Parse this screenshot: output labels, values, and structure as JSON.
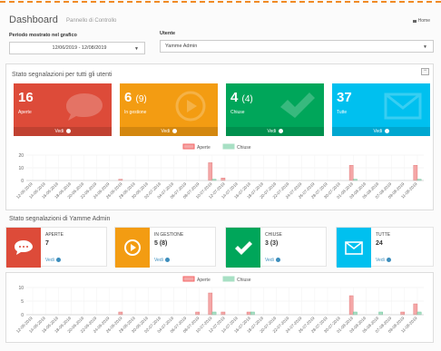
{
  "header": {
    "title": "Dashboard",
    "subtitle": "Pannello di Controllo",
    "home_label": "Home"
  },
  "filters": {
    "period_label": "Periodo mostrato nel grafico",
    "period_value": "12/06/2019 - 12/08/2019",
    "user_label": "Utente",
    "user_value": "Yamme Admin"
  },
  "section_all": {
    "title": "Stato segnalazioni per tutti gli utenti",
    "collapse_symbol": "−",
    "tiles": [
      {
        "num": "16",
        "sub": "",
        "label": "Aperte",
        "link": "Vedi",
        "color": "#dd4b39",
        "icon": "chat-icon"
      },
      {
        "num": "6",
        "sub": "(9)",
        "label": "In gestione",
        "link": "Vedi",
        "color": "#f39c12",
        "icon": "play-icon"
      },
      {
        "num": "4",
        "sub": "(4)",
        "label": "Chiuse",
        "link": "Vedi",
        "color": "#00a65a",
        "icon": "check-icon"
      },
      {
        "num": "37",
        "sub": "",
        "label": "Tutte",
        "link": "Vedi",
        "color": "#00c0ef",
        "icon": "envelope-icon"
      }
    ]
  },
  "section_user": {
    "title": "Stato segnalazioni di Yamme Admin",
    "tiles": [
      {
        "label": "APERTE",
        "value": "7",
        "link": "Vedi",
        "color": "#dd4b39",
        "icon": "chat-icon"
      },
      {
        "label": "IN GESTIONE",
        "value": "5 (8)",
        "link": "Vedi",
        "color": "#f39c12",
        "icon": "play-icon"
      },
      {
        "label": "CHIUSE",
        "value": "3 (3)",
        "link": "Vedi",
        "color": "#00a65a",
        "icon": "check-icon"
      },
      {
        "label": "TUTTE",
        "value": "24",
        "link": "Vedi",
        "color": "#00c0ef",
        "icon": "envelope-icon"
      }
    ]
  },
  "chart_data": [
    {
      "type": "bar",
      "ylim": [
        0,
        20
      ],
      "yticks": [
        "20",
        "10",
        "0"
      ],
      "categories": [
        "12-06-2019",
        "14-06-2019",
        "16-06-2019",
        "18-06-2019",
        "20-06-2019",
        "22-06-2019",
        "24-06-2019",
        "26-06-2019",
        "28-06-2019",
        "30-06-2019",
        "02-07-2019",
        "04-07-2019",
        "06-07-2019",
        "08-07-2019",
        "10-07-2019",
        "12-07-2019",
        "14-07-2019",
        "16-07-2019",
        "18-07-2019",
        "20-07-2019",
        "22-07-2019",
        "24-07-2019",
        "26-07-2019",
        "28-07-2019",
        "30-07-2019",
        "01-08-2019",
        "03-08-2019",
        "05-08-2019",
        "07-08-2019",
        "09-08-2019",
        "11-08-2019"
      ],
      "series": [
        {
          "name": "Aperte",
          "color": "#f4a6a6",
          "values": [
            0,
            0,
            0,
            0,
            0,
            0,
            0,
            1,
            0,
            0,
            0,
            0,
            0,
            0,
            14,
            2,
            0,
            0,
            0,
            0,
            0,
            0,
            0,
            0,
            0,
            12,
            0,
            0,
            0,
            0,
            12
          ]
        },
        {
          "name": "Chiuse",
          "color": "#a8e0c4",
          "values": [
            0,
            0,
            0,
            0,
            0,
            0,
            0,
            0,
            0,
            0,
            0,
            0,
            0,
            0,
            1,
            0,
            0,
            0,
            0,
            0,
            0,
            0,
            0,
            0,
            0,
            1,
            0,
            0,
            0,
            0,
            1
          ]
        }
      ]
    },
    {
      "type": "bar",
      "ylim": [
        0,
        10
      ],
      "yticks": [
        "10",
        "5",
        "0"
      ],
      "categories": [
        "12-06-2019",
        "14-06-2019",
        "16-06-2019",
        "18-06-2019",
        "20-06-2019",
        "22-06-2019",
        "24-06-2019",
        "26-06-2019",
        "28-06-2019",
        "30-06-2019",
        "02-07-2019",
        "04-07-2019",
        "06-07-2019",
        "08-07-2019",
        "10-07-2019",
        "12-07-2019",
        "14-07-2019",
        "16-07-2019",
        "18-07-2019",
        "20-07-2019",
        "22-07-2019",
        "24-07-2019",
        "26-07-2019",
        "28-07-2019",
        "30-07-2019",
        "01-08-2019",
        "03-08-2019",
        "05-08-2019",
        "07-08-2019",
        "09-08-2019",
        "11-08-2019"
      ],
      "series": [
        {
          "name": "Aperte",
          "color": "#f4a6a6",
          "values": [
            0,
            0,
            0,
            0,
            0,
            0,
            0,
            1,
            0,
            0,
            0,
            0,
            0,
            1,
            8,
            1,
            0,
            1,
            0,
            0,
            0,
            0,
            0,
            0,
            0,
            7,
            0,
            0,
            0,
            1,
            4
          ]
        },
        {
          "name": "Chiuse",
          "color": "#a8e0c4",
          "values": [
            0,
            0,
            0,
            0,
            0,
            0,
            0,
            0,
            0,
            0,
            0,
            0,
            0,
            0,
            1,
            0,
            0,
            1,
            0,
            0,
            0,
            0,
            0,
            0,
            0,
            1,
            0,
            1,
            0,
            0,
            1
          ]
        }
      ]
    }
  ]
}
